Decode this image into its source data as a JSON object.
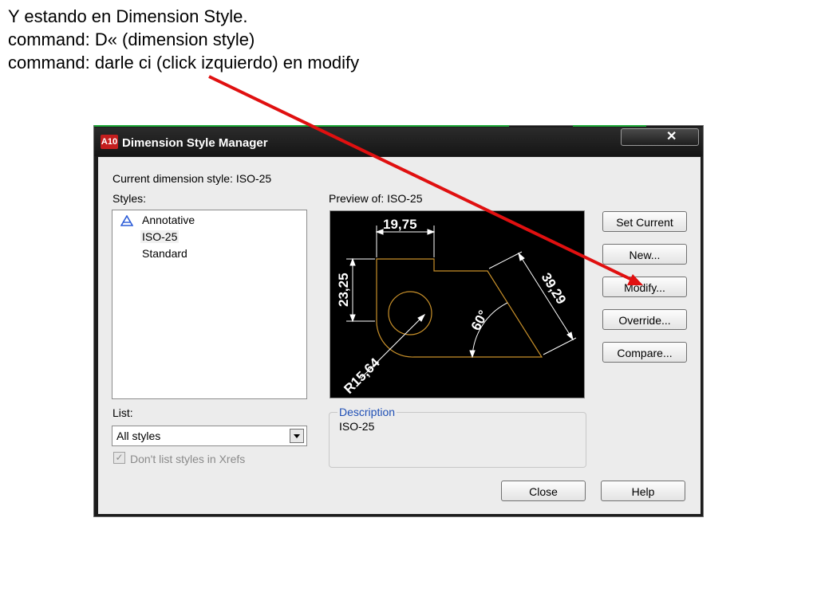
{
  "caption": {
    "line1": "Y estando en Dimension Style.",
    "line2": "command: D«  (dimension style)",
    "line3": "command: darle ci  (click izquierdo) en modify"
  },
  "dialog": {
    "title": "Dimension Style Manager",
    "app_icon_text": "A10",
    "close_glyph": "✕",
    "current_style_label": "Current dimension style: ISO-25",
    "styles_label": "Styles:",
    "styles": [
      "Annotative",
      "ISO-25",
      "Standard"
    ],
    "selected_style": "ISO-25",
    "preview_label": "Preview of: ISO-25",
    "preview": {
      "dim_horizontal": "19,75",
      "dim_vertical": "23,25",
      "dim_aligned": "39,29",
      "dim_angle": "60°",
      "dim_radius": "R15,64"
    },
    "list_label": "List:",
    "list_value": "All styles",
    "checkbox_label": "Don't list styles in Xrefs",
    "checkbox_checked": true,
    "description_legend": "Description",
    "description_value": "ISO-25",
    "buttons": {
      "set_current": "Set Current",
      "new": "New...",
      "modify": "Modify...",
      "override": "Override...",
      "compare": "Compare...",
      "close": "Close",
      "help": "Help"
    }
  },
  "colors": {
    "annotation_arrow": "#e01010",
    "preview_geometry": "#c8902a",
    "preview_dims": "#ffffff",
    "description_legend": "#1f4fb5"
  }
}
